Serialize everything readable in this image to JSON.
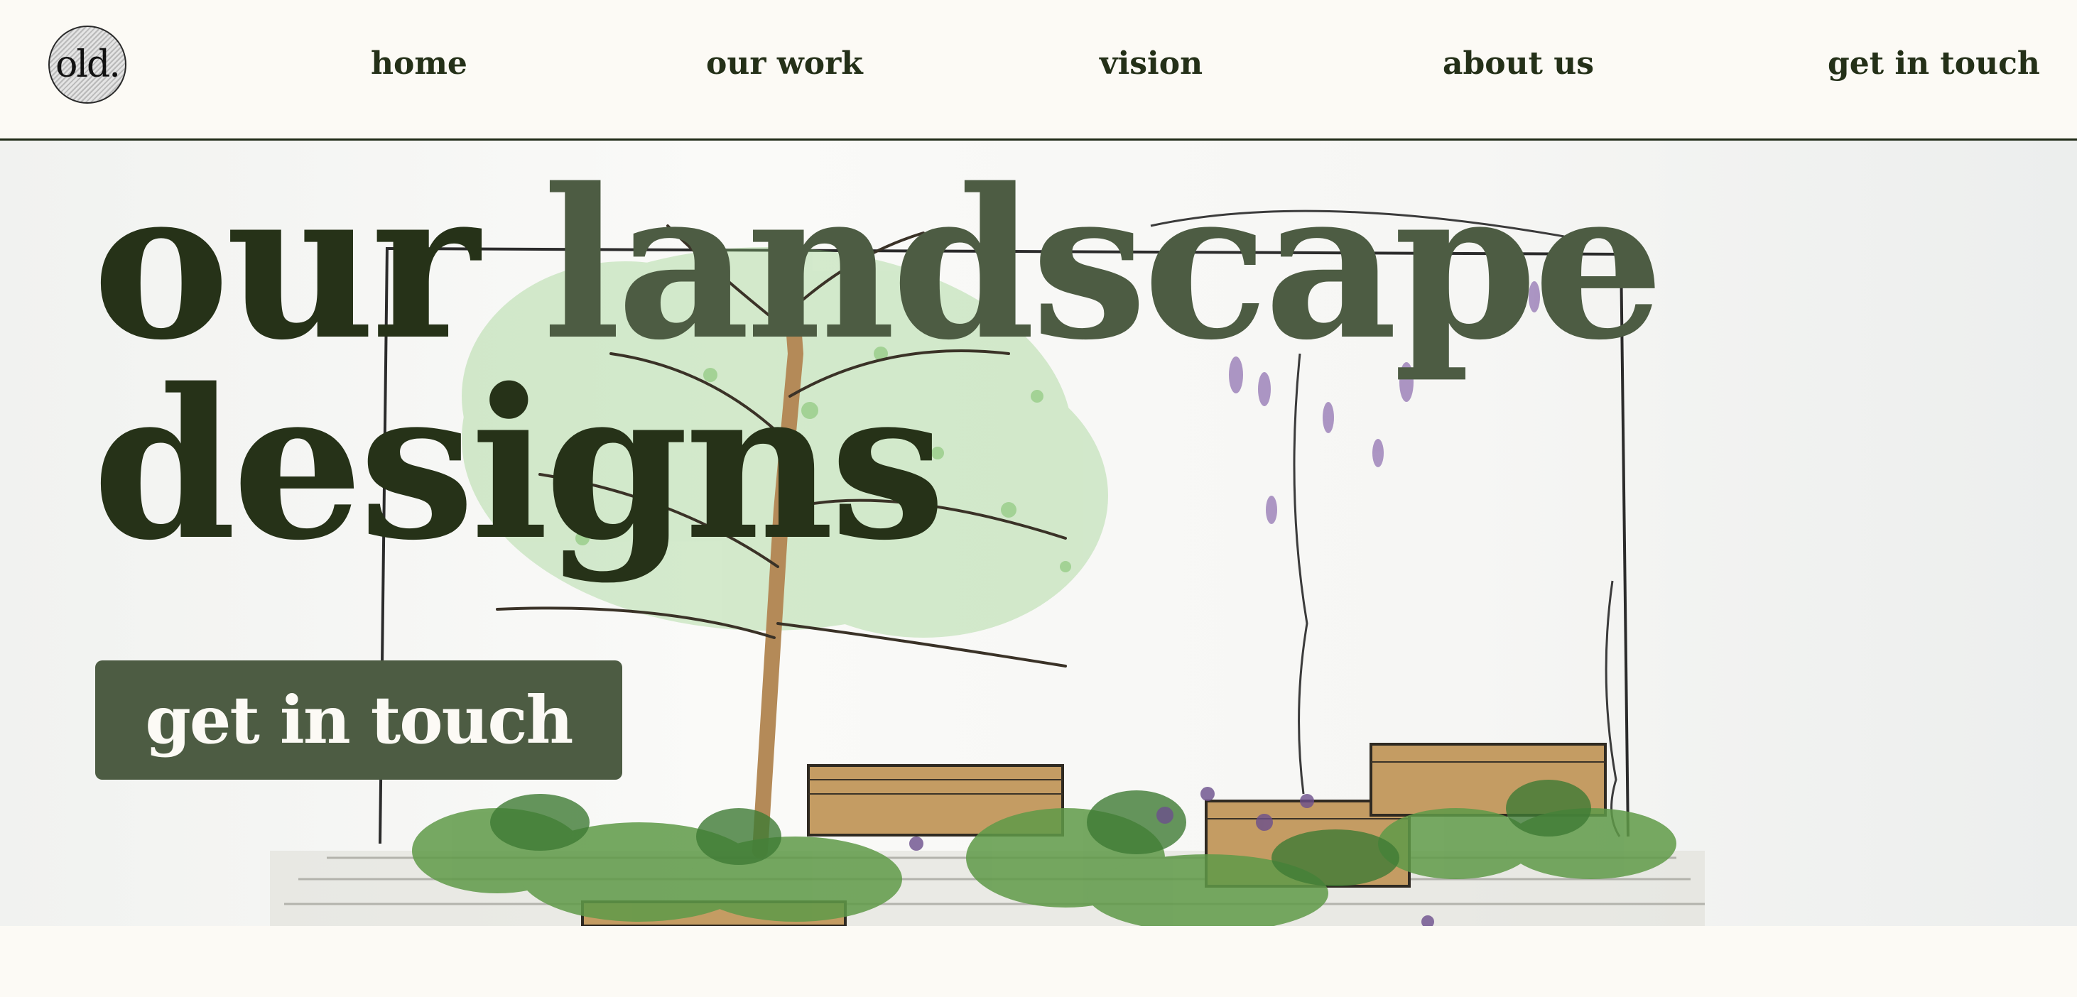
{
  "brand": {
    "logo_text": "old."
  },
  "nav": {
    "items": [
      {
        "label": "home"
      },
      {
        "label": "our work"
      },
      {
        "label": "vision"
      },
      {
        "label": "about us"
      },
      {
        "label": "get in touch"
      }
    ]
  },
  "hero": {
    "headline": {
      "word1": "our",
      "word2": "landscape",
      "word3": "designs"
    },
    "cta_label": "get in touch"
  },
  "colors": {
    "background": "#fcfaf5",
    "text_dark": "#263218",
    "accent_green": "#4d5c43",
    "nav_border": "#1f2a17"
  }
}
